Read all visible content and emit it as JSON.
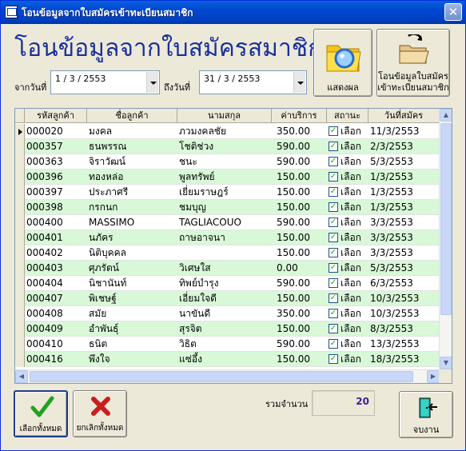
{
  "window": {
    "title": "โอนข้อมูลจากใบสมัครเข้าทะเบียนสมาชิก",
    "close_glyph": "✕"
  },
  "header": {
    "heading": "โอนข้อมูลจากใบสมัครสมาชิก"
  },
  "filters": {
    "from_label": "จากวันที่",
    "from_value": "1 / 3 / 2553",
    "to_label": "ถึงวันที่",
    "to_value": "31 / 3 / 2553"
  },
  "buttons": {
    "show_label": "แสดงผล",
    "transfer_label_1": "โอนข้อมูลใบสมัคร",
    "transfer_label_2": "เข้าทะเบียนสมาชิก",
    "select_all_label": "เลือกทั้งหมด",
    "deselect_all_label": "ยกเลิกทั้งหมด",
    "exit_label": "จบงาน"
  },
  "table": {
    "columns": [
      "รหัสลูกค้า",
      "ชื่อลูกค้า",
      "นามสกุล",
      "ค่าบริการ",
      "สถานะ",
      "วันที่สมัคร"
    ],
    "checkbox_label": "เลือก",
    "rows": [
      {
        "code": "000020",
        "first": "มงคล",
        "last": "ภวมงคลชัย",
        "fee": "350.00",
        "checked": true,
        "date": "11/3/2553"
      },
      {
        "code": "000357",
        "first": "ธนพรรณ",
        "last": "โชติช่วง",
        "fee": "590.00",
        "checked": true,
        "date": "2/3/2553"
      },
      {
        "code": "000363",
        "first": "จิราวัฒน์",
        "last": "ชนะ",
        "fee": "590.00",
        "checked": true,
        "date": "5/3/2553"
      },
      {
        "code": "000396",
        "first": "ทองหล่อ",
        "last": "พูลทรัพย์",
        "fee": "150.00",
        "checked": true,
        "date": "1/3/2553"
      },
      {
        "code": "000397",
        "first": "ประภาศรี",
        "last": "เยี่ยมราษฎร์",
        "fee": "150.00",
        "checked": true,
        "date": "1/3/2553"
      },
      {
        "code": "000398",
        "first": "กรกนก",
        "last": "ชมบุญ",
        "fee": "150.00",
        "checked": true,
        "date": "1/3/2553"
      },
      {
        "code": "000400",
        "first": "MASSIMO",
        "last": "TAGLIACOUO",
        "fee": "590.00",
        "checked": true,
        "date": "3/3/2553"
      },
      {
        "code": "000401",
        "first": "นภัคร",
        "last": "ถาษอาจนา",
        "fee": "150.00",
        "checked": true,
        "date": "3/3/2553"
      },
      {
        "code": "000402",
        "first": "นิติบุคคล",
        "last": "",
        "fee": "150.00",
        "checked": true,
        "date": "3/3/2553"
      },
      {
        "code": "000403",
        "first": "ศุภรัตน์",
        "last": "วิเศษใส",
        "fee": "0.00",
        "checked": true,
        "date": "5/3/2553"
      },
      {
        "code": "000404",
        "first": "นิชานันท์",
        "last": "ทิพย์บำรุง",
        "fee": "590.00",
        "checked": true,
        "date": "6/3/2553"
      },
      {
        "code": "000407",
        "first": "พิเชษฐ์",
        "last": "เอี่ยมใจดี",
        "fee": "150.00",
        "checked": true,
        "date": "10/3/2553"
      },
      {
        "code": "000408",
        "first": "สมัย",
        "last": "นาขันดี",
        "fee": "350.00",
        "checked": true,
        "date": "10/3/2553"
      },
      {
        "code": "000409",
        "first": "อำพันธุ์",
        "last": "สุรจิต",
        "fee": "150.00",
        "checked": true,
        "date": "8/3/2553"
      },
      {
        "code": "000410",
        "first": "ธนิต",
        "last": "วิธิต",
        "fee": "590.00",
        "checked": true,
        "date": "13/3/2553"
      },
      {
        "code": "000416",
        "first": "พึงใจ",
        "last": "แซ่อึ้ง",
        "fee": "150.00",
        "checked": true,
        "date": "18/3/2553"
      }
    ]
  },
  "summary": {
    "count_label": "รวมจำนวน",
    "count_value": "20"
  },
  "colors": {
    "title_blue": "#0047d0",
    "heading_blue": "#1a2f9c",
    "row_green": "#d8f8d8",
    "check_green": "#21a121",
    "delete_red": "#c81e1e"
  }
}
